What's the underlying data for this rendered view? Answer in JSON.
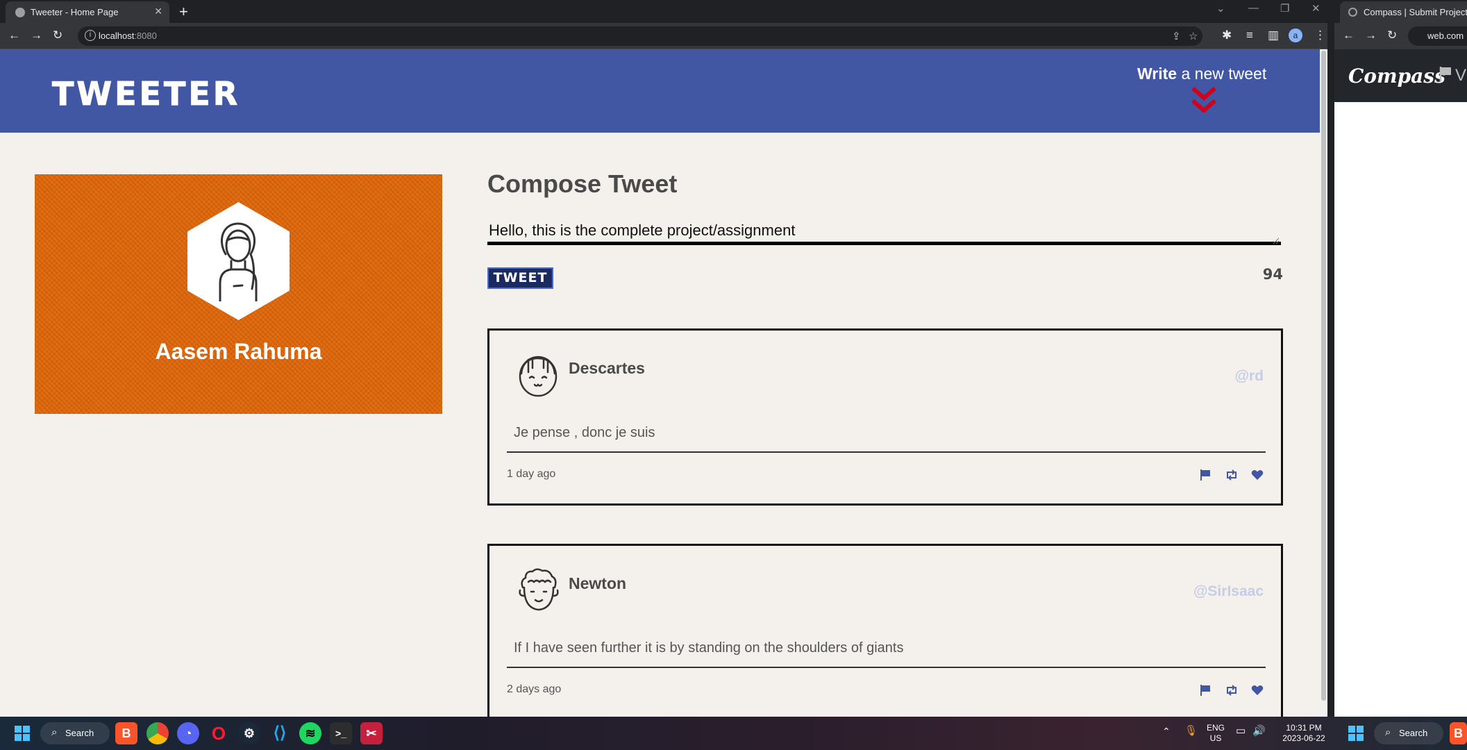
{
  "browser_left": {
    "tab_title": "Tweeter - Home Page",
    "tab_close": "✕",
    "new_tab": "+",
    "url_host": "localhost",
    "url_port": ":8080",
    "profile_initial": "a"
  },
  "site": {
    "logo": "TWEETER",
    "nav_write_bold": "Write",
    "nav_write_rest": " a new tweet",
    "accent_color": "#4157a3",
    "chevron_color": "#d0021b"
  },
  "profile": {
    "name": "Aasem Rahuma",
    "card_color": "#e56d10"
  },
  "compose": {
    "title": "Compose Tweet",
    "input_value": "Hello, this is the complete project/assignment",
    "button_label": "TWEET",
    "char_counter": "94"
  },
  "tweets": [
    {
      "author": "Descartes",
      "handle": "@rd",
      "text": "Je pense , donc je suis",
      "time": "1 day ago",
      "avatar_icon": "girl-avatar-icon"
    },
    {
      "author": "Newton",
      "handle": "@SirIsaac",
      "text": "If I have seen further it is by standing on the shoulders of giants",
      "time": "2 days ago",
      "avatar_icon": "curly-hair-avatar-icon"
    }
  ],
  "browser_right": {
    "tab_title": "Compass | Submit Project fo",
    "url": "web.com",
    "compass_logo": "Compass",
    "nav_fragment": "V"
  },
  "taskbar": {
    "search_label": "Search",
    "lang_top": "ENG",
    "lang_bottom": "US",
    "time": "10:31 PM",
    "date": "2023-06-22",
    "search_label_right": "Search"
  }
}
